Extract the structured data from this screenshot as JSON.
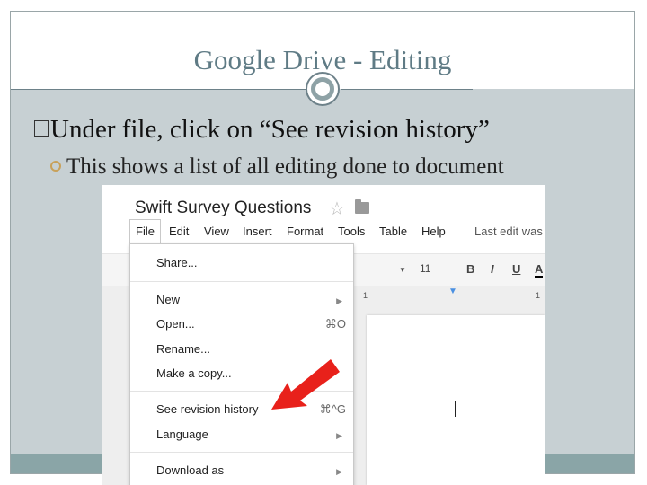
{
  "slide": {
    "title": "Google Drive - Editing",
    "bullet1": "Under file, click on “See revision history”",
    "bullet2": "This shows a list of all editing done to document"
  },
  "screenshot": {
    "doc_title": "Swift Survey Questions",
    "menubar": [
      "File",
      "Edit",
      "View",
      "Insert",
      "Format",
      "Tools",
      "Table",
      "Help"
    ],
    "last_edit": "Last edit was",
    "toolbar": {
      "font_size": "11",
      "bold": "B",
      "italic": "I",
      "underline": "U",
      "text_color": "A"
    },
    "ruler": {
      "left_mark": "1",
      "right_mark": "1"
    },
    "file_menu": {
      "share": "Share...",
      "new": "New",
      "open": "Open...",
      "open_shortcut": "⌘O",
      "rename": "Rename...",
      "make_copy": "Make a copy...",
      "revision_history": "See revision history",
      "revision_shortcut": "⌘^G",
      "language": "Language",
      "download_as": "Download as"
    },
    "colors": {
      "arrow": "#e8211b",
      "accent": "#5f7b85"
    }
  }
}
